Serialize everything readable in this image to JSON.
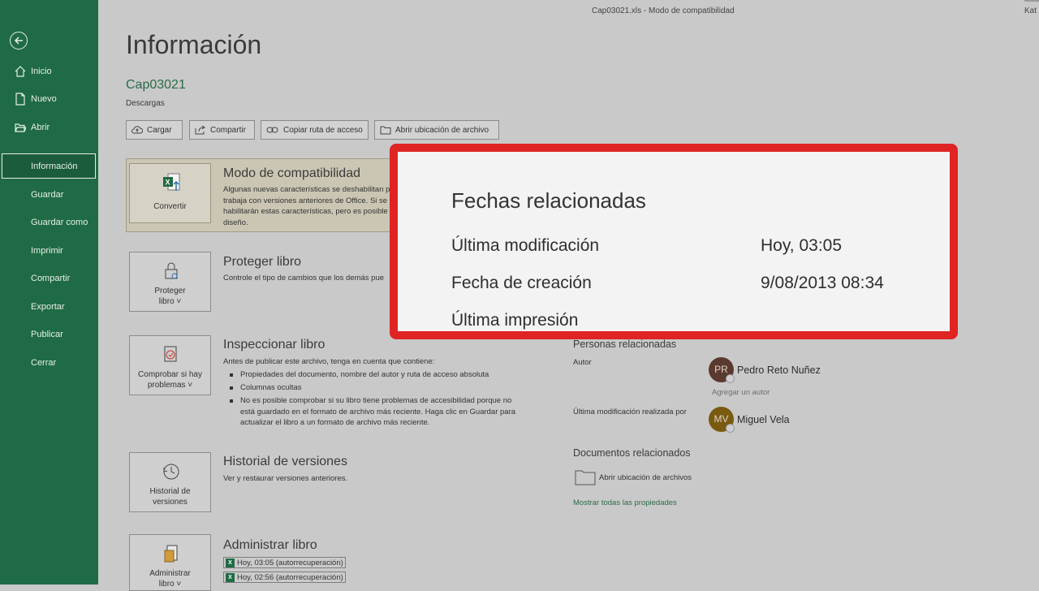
{
  "window": {
    "title": "Cap03021.xls  -  Modo de compatibilidad",
    "user_partial": "Kat"
  },
  "sidebar": {
    "items": [
      {
        "label": "Inicio",
        "icon": "home-icon"
      },
      {
        "label": "Nuevo",
        "icon": "new-file-icon"
      },
      {
        "label": "Abrir",
        "icon": "open-folder-icon"
      },
      {
        "label": "Información",
        "active": true
      },
      {
        "label": "Guardar"
      },
      {
        "label": "Guardar como"
      },
      {
        "label": "Imprimir"
      },
      {
        "label": "Compartir"
      },
      {
        "label": "Exportar"
      },
      {
        "label": "Publicar"
      },
      {
        "label": "Cerrar"
      }
    ]
  },
  "header": {
    "title": "Información",
    "file_name": "Cap03021",
    "file_location": "Descargas"
  },
  "actions": [
    "Cargar",
    "Compartir",
    "Copiar ruta de acceso",
    "Abrir ubicación de archivo"
  ],
  "compatibility": {
    "button": "Convertir",
    "title": "Modo de compatibilidad",
    "desc": "Algunas nuevas características se deshabilitarán para evitar problemas al trabajar con versiones anteriores de Office. Si se convierte este archivo, se habilitarán estas características, pero es posible que se produzcan cambios en el diseño.",
    "desc_lines": [
      "Algunas nuevas características se deshabilitan p",
      "trabaja con versiones anteriores de Office. Si se",
      "habilitarán estas características, pero es posible",
      "diseño."
    ]
  },
  "protect": {
    "button_line1": "Proteger",
    "button_line2": "libro ˅",
    "title": "Proteger libro",
    "desc": "Controle el tipo de cambios que los demás pue"
  },
  "inspect": {
    "button_line1": "Comprobar si hay",
    "button_line2": "problemas ˅",
    "title": "Inspeccionar libro",
    "desc": "Antes de publicar este archivo, tenga en cuenta que contiene:",
    "bullets": [
      "Propiedades del documento, nombre del autor y ruta de acceso absoluta",
      "Columnas ocultas",
      "No es posible comprobar si su libro tiene problemas de accesibilidad porque no está guardado en el formato de archivo más reciente. Haga clic en Guardar para actualizar el libro a un formato de archivo más reciente."
    ]
  },
  "history": {
    "button_line1": "Historial de",
    "button_line2": "versiones",
    "title": "Historial de versiones",
    "desc": "Ver y restaurar versiones anteriores."
  },
  "manage": {
    "button_line1": "Administrar",
    "button_line2": "libro ˅",
    "title": "Administrar libro",
    "versions": [
      "Hoy, 03:05 (autorrecuperación)",
      "Hoy, 02:56 (autorrecuperación)"
    ]
  },
  "related_people": {
    "heading": "Personas relacionadas",
    "author_label": "Autor",
    "author": {
      "initials": "PR",
      "name": "Pedro Reto Nuñez",
      "color": "#5a3a2e"
    },
    "add_author": "Agregar un autor",
    "modified_by_label": "Última modificación realizada por",
    "modified_by": {
      "initials": "MV",
      "name": "Miguel Vela",
      "color": "#7a5a10"
    }
  },
  "related_docs": {
    "heading": "Documentos relacionados",
    "open_location": "Abrir ubicación de archivos",
    "show_all": "Mostrar todas las propiedades"
  },
  "zoom": {
    "title": "Fechas relacionadas",
    "rows": [
      {
        "label": "Última modificación",
        "value": "Hoy, 03:05"
      },
      {
        "label": "Fecha de creación",
        "value": "9/08/2013 08:34"
      },
      {
        "label": "Última impresión",
        "value": ""
      }
    ],
    "border_color": "#e02424"
  }
}
